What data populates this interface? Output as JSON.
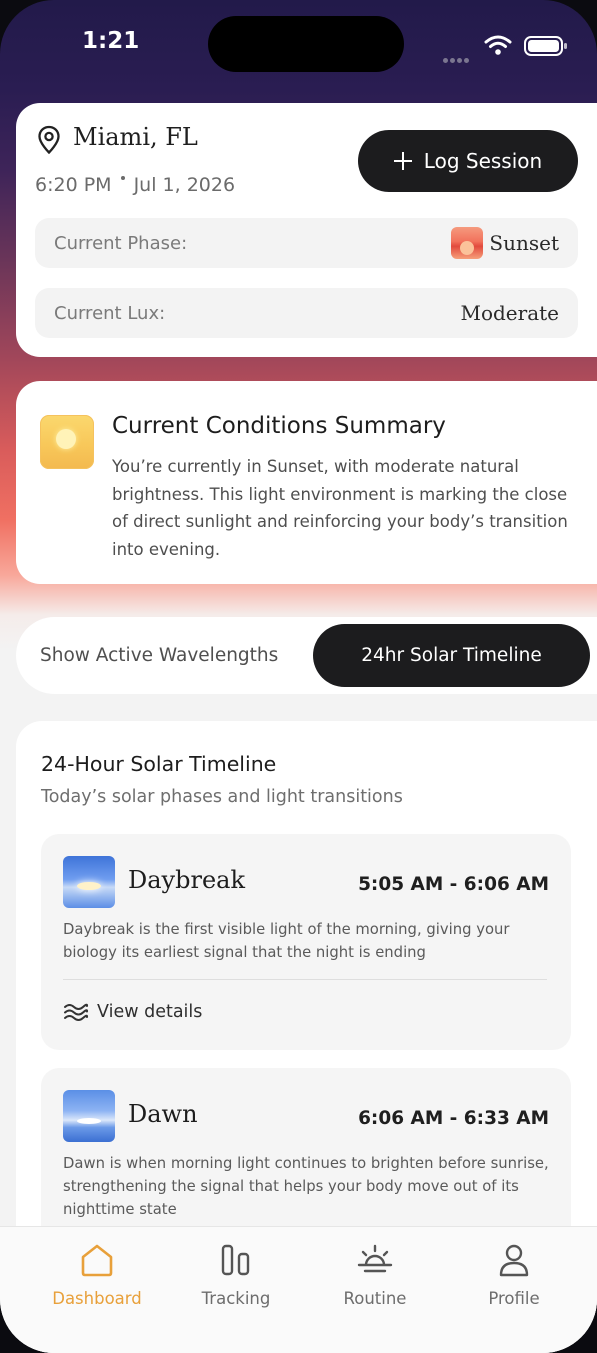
{
  "status_bar": {
    "time": "1:21"
  },
  "location_card": {
    "city": "Miami, FL",
    "time": "6:20 PM",
    "date": "Jul 1, 2026",
    "log_button_label": "Log Session",
    "phase_label": "Current Phase:",
    "phase_value": "Sunset",
    "lux_label": "Current Lux:",
    "lux_value": "Moderate"
  },
  "conditions": {
    "title": "Current Conditions Summary",
    "text": "You’re currently in Sunset, with moderate natural brightness. This light environment is marking the close of direct sunlight and reinforcing your body’s transition into evening."
  },
  "toggle": {
    "option_left": "Show Active Wavelengths",
    "option_right": "24hr Solar Timeline",
    "selected": "24hr Solar Timeline"
  },
  "timeline": {
    "title": "24-Hour Solar Timeline",
    "subtitle": "Today’s solar phases and light transitions",
    "phases": [
      {
        "name": "Daybreak",
        "time": "5:05 AM - 6:06 AM",
        "description": "Daybreak is the first visible light of the morning, giving your biology its earliest signal that the night is ending",
        "details_label": "View details",
        "icon": "daybreak-icon"
      },
      {
        "name": "Dawn",
        "time": "6:06 AM - 6:33 AM",
        "description": "Dawn is when morning light continues to brighten before sunrise, strengthening the signal that helps your body move out of its nighttime state",
        "icon": "dawn-icon"
      }
    ]
  },
  "tab_bar": {
    "active": "Dashboard",
    "accent_color": "#E8A03A",
    "tabs": [
      {
        "label": "Dashboard",
        "icon": "home-icon"
      },
      {
        "label": "Tracking",
        "icon": "tracking-icon"
      },
      {
        "label": "Routine",
        "icon": "sunrise-icon"
      },
      {
        "label": "Profile",
        "icon": "person-icon"
      }
    ]
  }
}
